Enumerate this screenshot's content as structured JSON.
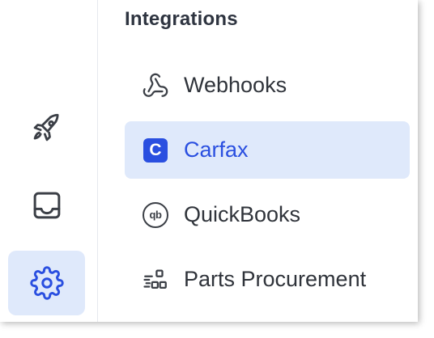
{
  "rail": {
    "items": [
      {
        "icon": "rocket-icon",
        "active": false
      },
      {
        "icon": "inbox-icon",
        "active": false
      },
      {
        "icon": "gear-icon",
        "active": true
      }
    ]
  },
  "panel": {
    "section_title": "Integrations",
    "items": [
      {
        "label": "Webhooks",
        "icon": "webhook-icon",
        "selected": false
      },
      {
        "label": "Carfax",
        "icon": "carfax-logo-icon",
        "icon_glyph": "C",
        "selected": true
      },
      {
        "label": "QuickBooks",
        "icon": "quickbooks-icon",
        "icon_glyph": "qb",
        "selected": false
      },
      {
        "label": "Parts Procurement",
        "icon": "parts-procurement-icon",
        "selected": false
      }
    ]
  },
  "colors": {
    "accent": "#2a4fe0",
    "active_background": "#dfe9fb",
    "text": "#2f333a",
    "icon": "#3b3f46"
  }
}
